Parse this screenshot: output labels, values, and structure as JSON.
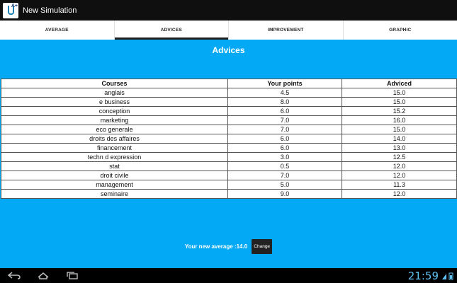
{
  "app": {
    "title": "New Simulation"
  },
  "tabs": [
    {
      "label": "AVERAGE",
      "active": false
    },
    {
      "label": "ADVICES",
      "active": true
    },
    {
      "label": "IMPROVEMENT",
      "active": false
    },
    {
      "label": "GRAPHIC",
      "active": false
    }
  ],
  "page": {
    "title": "Advices"
  },
  "table": {
    "headers": [
      "Courses",
      "Your points",
      "Adviced"
    ],
    "rows": [
      [
        "anglais",
        "4.5",
        "15.0"
      ],
      [
        "e business",
        "8.0",
        "15.0"
      ],
      [
        "conception",
        "6.0",
        "15.2"
      ],
      [
        "marketing",
        "7.0",
        "16.0"
      ],
      [
        "eco generale",
        "7.0",
        "15.0"
      ],
      [
        "droits des affaires",
        "6.0",
        "14.0"
      ],
      [
        "financement",
        "6.0",
        "13.0"
      ],
      [
        "techn d expression",
        "3.0",
        "12.5"
      ],
      [
        "stat",
        "0.5",
        "12.0"
      ],
      [
        "droit civile",
        "7.0",
        "12.0"
      ],
      [
        "management",
        "5.0",
        "11.3"
      ],
      [
        "seminaire",
        "9.0",
        "12.0"
      ]
    ]
  },
  "footer": {
    "average_label": "Your new average :14.0",
    "change_label": "Change"
  },
  "statusbar": {
    "clock": "21:59"
  },
  "colors": {
    "content_bg": "#03a9f4",
    "clock": "#5fc2f2"
  }
}
